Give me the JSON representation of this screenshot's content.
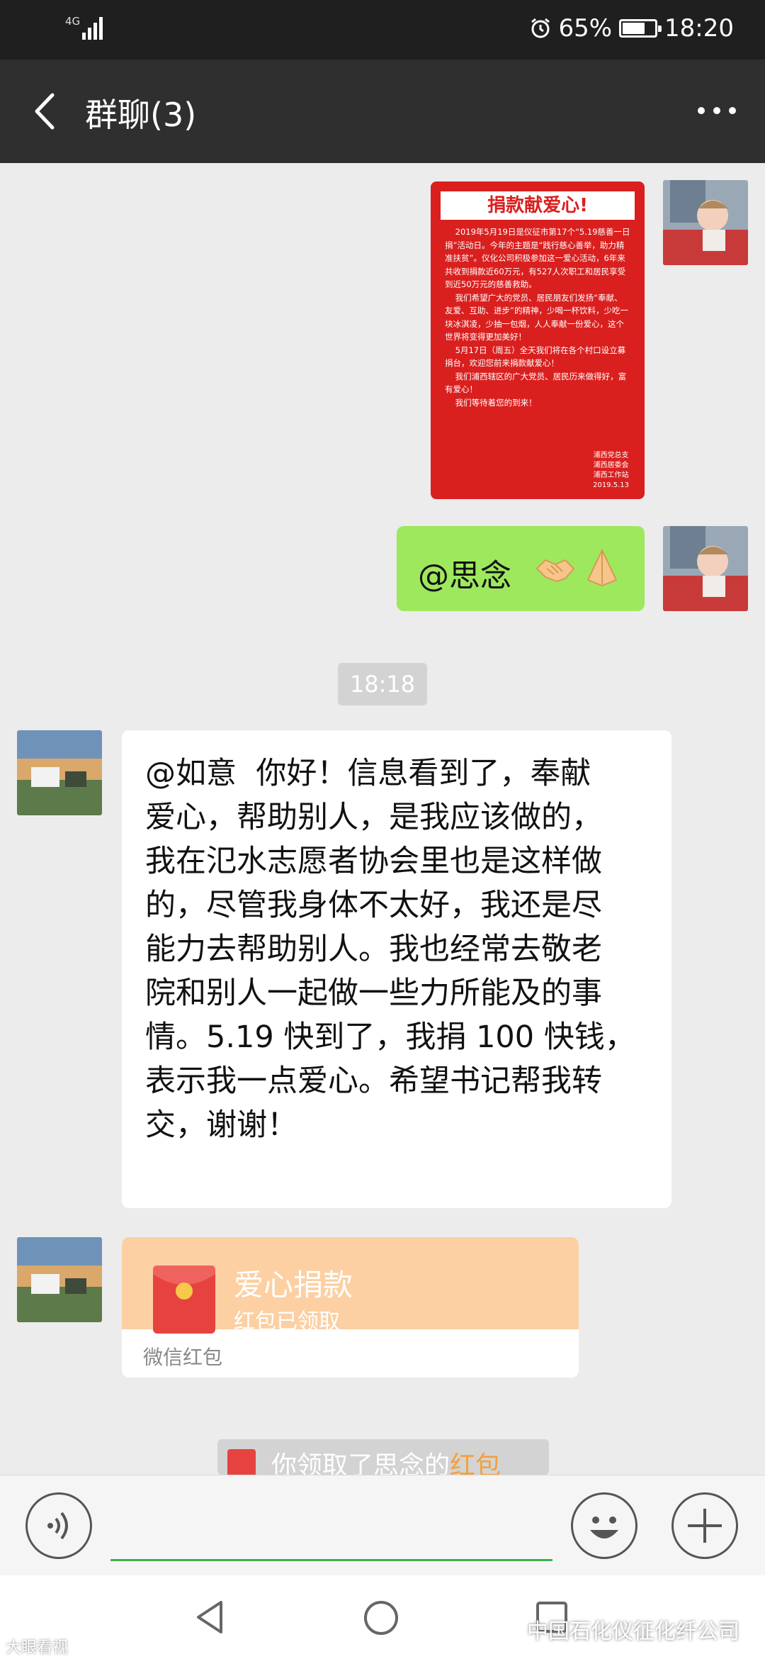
{
  "status_bar": {
    "network": "4G",
    "battery": "65%",
    "battery_level": 0.65,
    "time": "18:20"
  },
  "header": {
    "title": "群聊(3)"
  },
  "messages": {
    "poster": {
      "heading": "捐款献爱心!",
      "body": "    2019年5月19日是仪征市第17个“5.19慈善一日捐”活动日。今年的主题是“践行慈心善举，助力精准扶贫”。仪化公司积极参加这一爱心活动，6年来共收到捐款近60万元，有527人次职工和居民享受到近50万元的慈善救助。\n    我们希望广大的党员、居民朋友们发扬“奉献、友爱、互助、进步”的精神，少喝一杯饮料，少吃一块冰淇凌，少抽一包烟，人人奉献一份爱心，这个世界将变得更加美好！\n    5月17日（周五）全天我们将在各个村口设立募捐台，欢迎您前来捐款献爱心！\n    我们浦西辖区的广大党员、居民历来做得好，富有爱心！\n    我们等待着您的到来！",
      "signature": "浦西党总支\n浦西居委会\n浦西工作站\n2019.5.13"
    },
    "mention": {
      "text": "@思念"
    },
    "timestamp": "18:18",
    "reply": {
      "text": "@如意  你好！信息看到了，奉献\n爱心，帮助别人，是我应该做的，\n我在氾水志愿者协会里也是这样做\n的，尽管我身体不太好，我还是尽\n能力去帮助别人。我也经常去敬老\n院和别人一起做一些力所能及的事\n情。5.19 快到了，我捐 100 快钱，\n表示我一点爱心。希望书记帮我转\n交，谢谢！"
    },
    "red_packet": {
      "title": "爱心捐款",
      "status": "红包已领取",
      "footer": "微信红包"
    },
    "system": {
      "prefix": "你领取了思念的",
      "highlight": "红包"
    }
  },
  "watermarks": {
    "left": "大眼看视",
    "right": "中国石化仪征化纤公司"
  },
  "colors": {
    "bubble_green": "#9ee85e",
    "red_packet": "#fcd0a3",
    "poster_red": "#d9201f",
    "input_underline": "#3cb34a"
  },
  "icons": [
    "back-arrow-icon",
    "more-icon",
    "voice-icon",
    "emoji-icon",
    "plus-icon",
    "nav-back-icon",
    "nav-home-icon",
    "nav-recent-icon",
    "signal-icon",
    "alarm-icon",
    "battery-icon",
    "handshake-emoji-icon",
    "praying-hands-emoji-icon",
    "red-envelope-icon"
  ]
}
